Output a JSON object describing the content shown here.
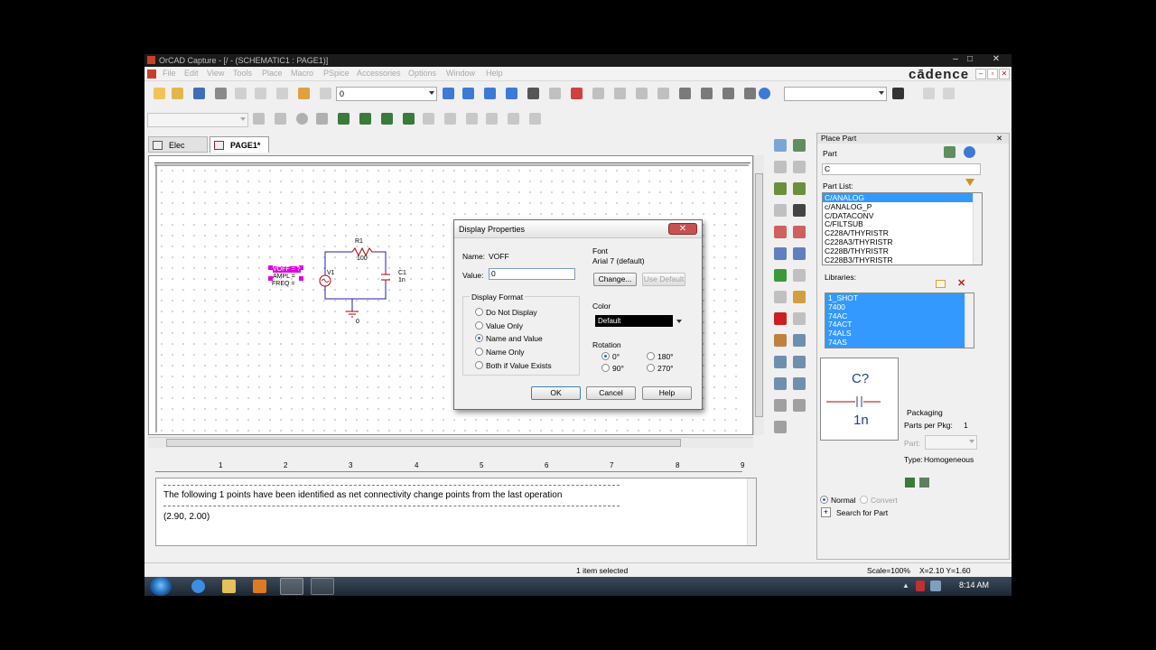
{
  "window": {
    "title": "OrCAD Capture - [/ - (SCHEMATIC1 : PAGE1)]",
    "brand": "cādence"
  },
  "menu": [
    "File",
    "Edit",
    "View",
    "Tools",
    "Place",
    "Macro",
    "PSpice",
    "Accessories",
    "Options",
    "Window",
    "Help"
  ],
  "toolbar": {
    "zoom_combo_value": "0",
    "search_combo_value": ""
  },
  "tabs": [
    {
      "label": "Elec"
    },
    {
      "label": "PAGE1*"
    }
  ],
  "schematic": {
    "r1_ref": "R1",
    "r1_val": "100",
    "v1_ref": "V1",
    "voff": "VOFF = ?",
    "ampl": "AMPL = ",
    "freq": "FREQ = ",
    "c1_ref": "C1",
    "c1_val": "1n",
    "gnd": "0"
  },
  "dialog": {
    "title": "Display Properties",
    "name_label": "Name:",
    "name_value": "VOFF",
    "value_label": "Value:",
    "value_input": "0",
    "display_format_label": "Display Format",
    "formats": [
      "Do Not Display",
      "Value Only",
      "Name and Value",
      "Name Only",
      "Both if Value Exists"
    ],
    "font_label": "Font",
    "font_value": "Arial 7 (default)",
    "change_btn": "Change...",
    "use_default_btn": "Use Default",
    "color_label": "Color",
    "color_value": "Default",
    "rotation_label": "Rotation",
    "rotations": [
      "0°",
      "180°",
      "90°",
      "270°"
    ],
    "ok_btn": "OK",
    "cancel_btn": "Cancel",
    "help_btn": "Help"
  },
  "output": {
    "ruler_numbers": [
      "1",
      "2",
      "3",
      "4",
      "5",
      "6",
      "7",
      "8",
      "9"
    ],
    "line1": "The following 1 points have been identified as net connectivity change points from the last operation",
    "line2": "(2.90, 2.00)"
  },
  "place_part": {
    "title": "Place Part",
    "part_label": "Part",
    "part_value": "C",
    "part_list_label": "Part List:",
    "parts": [
      "C/ANALOG",
      "c/ANALOG_P",
      "C/DATACONV",
      "C/FILTSUB",
      "C228A/THYRISTR",
      "C228A3/THYRISTR",
      "C228B/THYRISTR",
      "C228B3/THYRISTR"
    ],
    "libraries_label": "Libraries:",
    "libraries": [
      "1_SHOT",
      "7400",
      "74AC",
      "74ACT",
      "74ALS",
      "74AS"
    ],
    "preview_ref": "C?",
    "preview_val": "1n",
    "packaging_label": "Packaging",
    "parts_per_pkg_label": "Parts per Pkg:",
    "parts_per_pkg_value": "1",
    "part_label2": "Part:",
    "type_label": "Type:",
    "type_value": "Homogeneous",
    "normal_label": "Normal",
    "convert_label": "Convert",
    "search_label": "Search for Part"
  },
  "status": {
    "selection": "1 item selected",
    "scale": "Scale=100%",
    "coords": "X=2.10  Y=1.60"
  },
  "taskbar": {
    "clock": "8:14 AM"
  },
  "colors": {
    "selection_blue": "#3399ff",
    "selected_part_magenta": "#e000e0",
    "schematic_red": "#b00000",
    "wire_blue": "#1f1fbf"
  }
}
